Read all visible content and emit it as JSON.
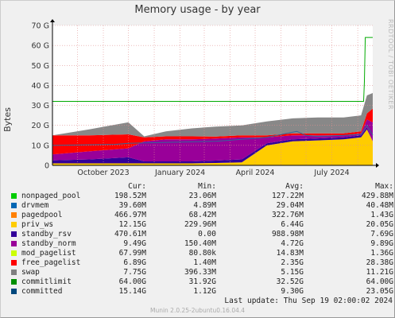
{
  "title": "Memory usage - by year",
  "side_text": "RRDTOOL / TOBI OETIKER",
  "ylabel": "Bytes",
  "chart_data": {
    "type": "area",
    "title": "Memory usage - by year",
    "ylabel": "Bytes",
    "ylim": [
      0,
      70
    ],
    "y_unit": "G",
    "y_ticks": [
      "0",
      "10 G",
      "20 G",
      "30 G",
      "40 G",
      "50 G",
      "60 G",
      "70 G"
    ],
    "x_ticks": [
      "October 2023",
      "January 2024",
      "April 2024",
      "July 2024"
    ],
    "x_range": [
      "2023-09-01",
      "2024-09-19"
    ],
    "grid": true,
    "stacked_series": [
      {
        "name": "priv_ws",
        "color": "#FFCC00",
        "x": [
          "2023-09-01",
          "2023-10-15",
          "2023-12-01",
          "2023-12-20",
          "2024-01-15",
          "2024-02-15",
          "2024-03-15",
          "2024-04-15",
          "2024-05-15",
          "2024-06-15",
          "2024-07-15",
          "2024-08-15",
          "2024-09-05",
          "2024-09-12",
          "2024-09-19"
        ],
        "values": [
          1.0,
          1.0,
          1.0,
          1.0,
          1.0,
          1.0,
          1.2,
          1.5,
          10.0,
          12.0,
          12.5,
          13.0,
          14.0,
          18.0,
          12.0
        ]
      },
      {
        "name": "standby_rsv",
        "color": "#330099",
        "x": [
          "2023-09-01",
          "2023-10-15",
          "2023-12-01",
          "2023-12-20",
          "2024-01-15",
          "2024-02-15",
          "2024-03-15",
          "2024-04-15",
          "2024-05-15",
          "2024-06-15",
          "2024-07-15",
          "2024-08-15",
          "2024-09-05",
          "2024-09-12",
          "2024-09-19"
        ],
        "values": [
          1.5,
          2.0,
          3.0,
          1.0,
          1.0,
          1.0,
          1.2,
          1.5,
          1.0,
          1.0,
          1.0,
          1.0,
          1.0,
          1.0,
          0.0
        ]
      },
      {
        "name": "standby_norm",
        "color": "#990099",
        "x": [
          "2023-09-01",
          "2023-10-15",
          "2023-12-01",
          "2023-12-20",
          "2024-01-15",
          "2024-02-15",
          "2024-03-15",
          "2024-04-15",
          "2024-05-15",
          "2024-06-15",
          "2024-07-15",
          "2024-08-15",
          "2024-09-05",
          "2024-09-12",
          "2024-09-19"
        ],
        "values": [
          3.0,
          4.0,
          4.5,
          10.0,
          11.0,
          11.0,
          11.0,
          11.0,
          3.0,
          2.0,
          1.5,
          1.0,
          1.0,
          4.0,
          9.5
        ]
      },
      {
        "name": "free_pagelist",
        "color": "#FF0000",
        "x": [
          "2023-09-01",
          "2023-10-15",
          "2023-12-01",
          "2023-12-20",
          "2024-01-15",
          "2024-02-15",
          "2024-03-15",
          "2024-04-15",
          "2024-05-15",
          "2024-06-15",
          "2024-07-15",
          "2024-08-15",
          "2024-09-05",
          "2024-09-12",
          "2024-09-19"
        ],
        "values": [
          9.5,
          8.0,
          7.0,
          2.0,
          1.5,
          1.5,
          1.0,
          1.0,
          1.0,
          1.0,
          1.0,
          1.0,
          1.0,
          3.0,
          6.9
        ]
      },
      {
        "name": "swap",
        "color": "#888888",
        "x": [
          "2023-09-01",
          "2023-10-15",
          "2023-12-01",
          "2023-12-20",
          "2024-01-15",
          "2024-02-15",
          "2024-03-15",
          "2024-04-15",
          "2024-05-15",
          "2024-06-15",
          "2024-07-15",
          "2024-08-15",
          "2024-09-05",
          "2024-09-12",
          "2024-09-19"
        ],
        "values": [
          0.0,
          3.0,
          6.0,
          0.5,
          2.5,
          4.0,
          5.0,
          5.0,
          7.0,
          7.5,
          8.0,
          8.0,
          8.0,
          9.0,
          7.8
        ]
      }
    ],
    "line_series": [
      {
        "name": "commitlimit",
        "color": "#00AA00",
        "x": [
          "2023-09-01",
          "2024-09-08",
          "2024-09-09",
          "2024-09-10",
          "2024-09-19"
        ],
        "values": [
          32.0,
          32.0,
          42.0,
          64.0,
          64.0
        ]
      },
      {
        "name": "committed",
        "color": "#336699",
        "x": [
          "2023-09-01",
          "2023-11-15",
          "2023-12-01",
          "2024-01-15",
          "2024-03-15",
          "2024-05-15",
          "2024-06-20",
          "2024-07-01",
          "2024-07-15",
          "2024-08-15",
          "2024-09-05",
          "2024-09-12",
          "2024-09-19"
        ],
        "values": [
          10.0,
          10.5,
          11.0,
          11.5,
          12.0,
          14.0,
          17.0,
          15.0,
          14.5,
          15.0,
          15.5,
          20.0,
          15.1
        ]
      }
    ]
  },
  "legend": {
    "headers": [
      "Cur:",
      "Min:",
      "Avg:",
      "Max:"
    ],
    "rows": [
      {
        "name": "nonpaged_pool",
        "color": "#00CC00",
        "cur": "198.52M",
        "min": "23.06M",
        "avg": "127.22M",
        "max": "429.88M"
      },
      {
        "name": "drvmem",
        "color": "#0066B3",
        "cur": "39.60M",
        "min": "4.89M",
        "avg": "29.04M",
        "max": "40.48M"
      },
      {
        "name": "pagedpool",
        "color": "#FF8000",
        "cur": "466.97M",
        "min": "68.42M",
        "avg": "322.76M",
        "max": "1.43G"
      },
      {
        "name": "priv_ws",
        "color": "#FFCC00",
        "cur": "12.15G",
        "min": "229.96M",
        "avg": "6.44G",
        "max": "20.05G"
      },
      {
        "name": "standby_rsv",
        "color": "#330099",
        "cur": "470.61M",
        "min": "0.00",
        "avg": "988.98M",
        "max": "7.69G"
      },
      {
        "name": "standby_norm",
        "color": "#990099",
        "cur": "9.49G",
        "min": "150.40M",
        "avg": "4.72G",
        "max": "9.89G"
      },
      {
        "name": "mod_pagelist",
        "color": "#CCFF00",
        "cur": "67.99M",
        "min": "80.80k",
        "avg": "14.83M",
        "max": "1.36G"
      },
      {
        "name": "free_pagelist",
        "color": "#FF0000",
        "cur": "6.89G",
        "min": "1.40M",
        "avg": "2.35G",
        "max": "28.38G"
      },
      {
        "name": "swap",
        "color": "#808080",
        "cur": "7.75G",
        "min": "396.33M",
        "avg": "5.15G",
        "max": "11.21G"
      },
      {
        "name": "commitlimit",
        "color": "#008F00",
        "cur": "64.00G",
        "min": "31.92G",
        "avg": "32.52G",
        "max": "64.00G"
      },
      {
        "name": "committed",
        "color": "#00487D",
        "cur": "15.14G",
        "min": "1.12G",
        "avg": "9.30G",
        "max": "23.05G"
      }
    ]
  },
  "last_update": "Last update:  Thu Sep 19 02:00:02 2024",
  "munin_version": "Munin 2.0.25-2ubuntu0.16.04.4"
}
